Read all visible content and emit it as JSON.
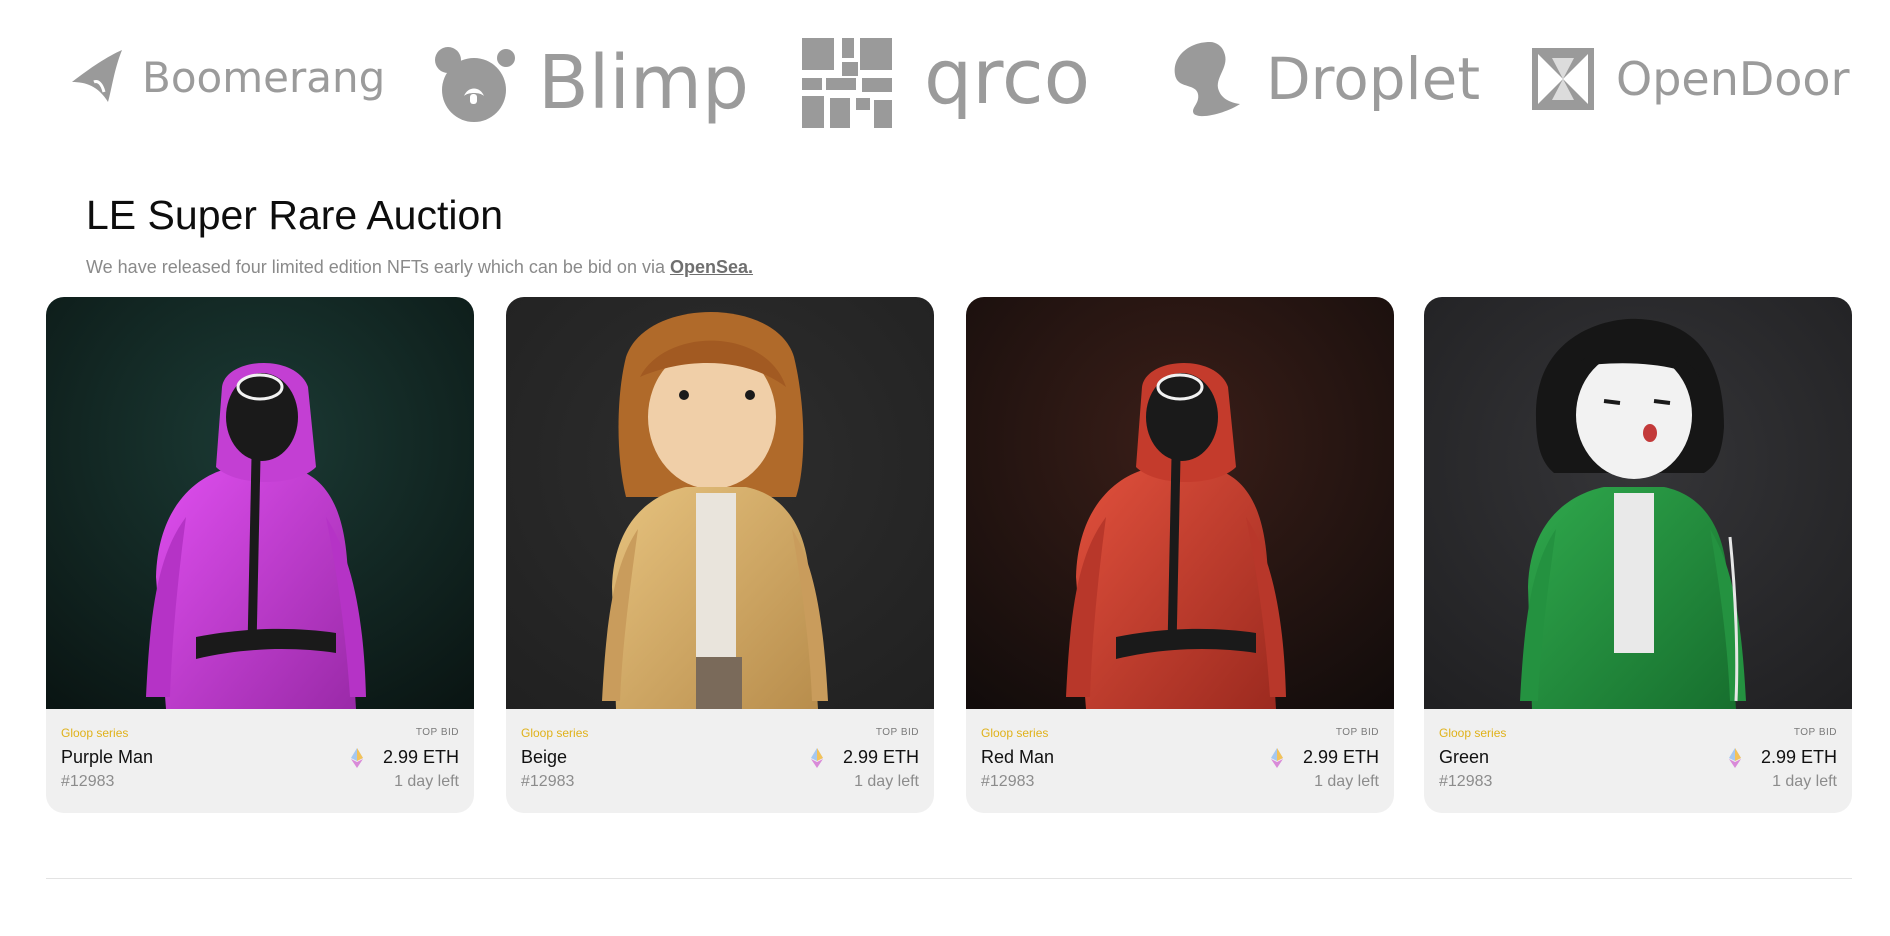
{
  "logos": [
    {
      "name": "Boomerang",
      "icon": "boomerang-icon"
    },
    {
      "name": "Blimp",
      "icon": "bear-icon"
    },
    {
      "name": "qrco",
      "icon": "qr-icon"
    },
    {
      "name": "Droplet",
      "icon": "droplet-icon"
    },
    {
      "name": "OpenDoor",
      "icon": "opendoor-icon"
    }
  ],
  "auction": {
    "title": "LE Super Rare Auction",
    "subtitle": "We have released four limited edition NFTs early which can be bid on via",
    "link_label": "OpenSea."
  },
  "cards": [
    {
      "series": "Gloop series",
      "top_bid_label": "TOP BID",
      "name": "Purple Man",
      "price": "2.99 ETH",
      "number": "#12983",
      "time_left": "1 day left",
      "bg": "#10201d",
      "color": "#c53ad6"
    },
    {
      "series": "Gloop series",
      "top_bid_label": "TOP BID",
      "name": "Beige",
      "price": "2.99 ETH",
      "number": "#12983",
      "time_left": "1 day left",
      "bg": "#262626",
      "color": "#d8b070"
    },
    {
      "series": "Gloop series",
      "top_bid_label": "TOP BID",
      "name": "Red Man",
      "price": "2.99 ETH",
      "number": "#12983",
      "time_left": "1 day left",
      "bg": "#1a1312",
      "color": "#c8392a"
    },
    {
      "series": "Gloop series",
      "top_bid_label": "TOP BID",
      "name": "Green",
      "price": "2.99 ETH",
      "number": "#12983",
      "time_left": "1 day left",
      "bg": "#232325",
      "color": "#1f8f3c"
    }
  ],
  "colors": {
    "accent": "#e0b21a",
    "logo_gray": "#9b9b9b"
  }
}
